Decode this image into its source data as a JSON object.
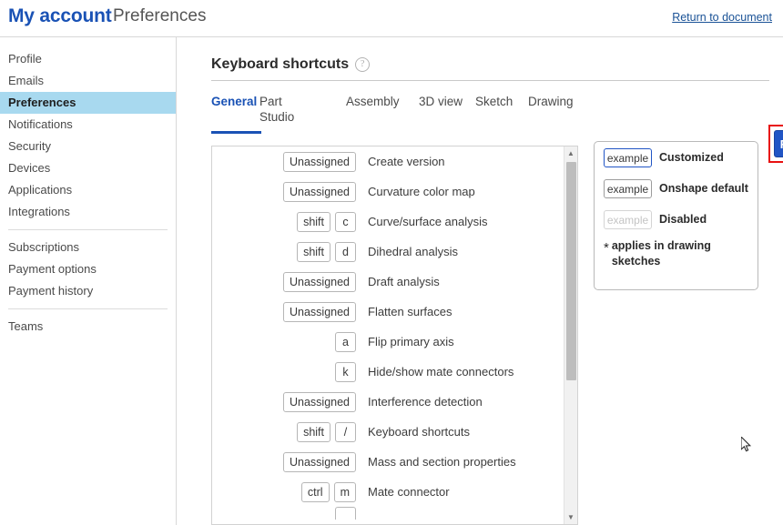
{
  "topbar": {
    "brand": "My account",
    "subtitle": "Preferences",
    "return_link": "Return to document"
  },
  "sidebar": {
    "group1": [
      {
        "label": "Profile",
        "active": false
      },
      {
        "label": "Emails",
        "active": false
      },
      {
        "label": "Preferences",
        "active": true
      },
      {
        "label": "Notifications",
        "active": false
      },
      {
        "label": "Security",
        "active": false
      },
      {
        "label": "Devices",
        "active": false
      },
      {
        "label": "Applications",
        "active": false
      },
      {
        "label": "Integrations",
        "active": false
      }
    ],
    "group2": [
      {
        "label": "Subscriptions",
        "active": false
      },
      {
        "label": "Payment options",
        "active": false
      },
      {
        "label": "Payment history",
        "active": false
      }
    ],
    "group3": [
      {
        "label": "Teams",
        "active": false
      }
    ]
  },
  "main": {
    "section_title": "Keyboard shortcuts",
    "help_icon": "question-mark-icon",
    "tabs": [
      {
        "label": "General",
        "active": true
      },
      {
        "label": "Part Studio",
        "active": false
      },
      {
        "label": "Assembly",
        "active": false
      },
      {
        "label": "3D view",
        "active": false
      },
      {
        "label": "Sketch",
        "active": false
      },
      {
        "label": "Drawing",
        "active": false
      }
    ],
    "reset_button": "Reset all",
    "highlight_color": "#e81111",
    "accent_color": "#1a52b5",
    "shortcuts": [
      {
        "keys": [
          "Unassigned"
        ],
        "label": "Create version"
      },
      {
        "keys": [
          "Unassigned"
        ],
        "label": "Curvature color map"
      },
      {
        "keys": [
          "shift",
          "c"
        ],
        "label": "Curve/surface analysis"
      },
      {
        "keys": [
          "shift",
          "d"
        ],
        "label": "Dihedral analysis"
      },
      {
        "keys": [
          "Unassigned"
        ],
        "label": "Draft analysis"
      },
      {
        "keys": [
          "Unassigned"
        ],
        "label": "Flatten surfaces"
      },
      {
        "keys": [
          "a"
        ],
        "label": "Flip primary axis"
      },
      {
        "keys": [
          "k"
        ],
        "label": "Hide/show mate connectors"
      },
      {
        "keys": [
          "Unassigned"
        ],
        "label": "Interference detection"
      },
      {
        "keys": [
          "shift",
          "/"
        ],
        "label": "Keyboard shortcuts"
      },
      {
        "keys": [
          "Unassigned"
        ],
        "label": "Mass and section properties"
      },
      {
        "keys": [
          "ctrl",
          "m"
        ],
        "label": "Mate connector"
      }
    ],
    "scrollbar": {
      "up_arrow": "scroll-up-icon",
      "down_arrow": "scroll-down-icon"
    },
    "legend": [
      {
        "chip": "example",
        "label": "Customized",
        "style": "chip-custom"
      },
      {
        "chip": "example",
        "label": "Onshape default",
        "style": "chip-default"
      },
      {
        "chip": "example",
        "label": "Disabled",
        "style": "chip-disabled"
      }
    ],
    "legend_note_star": "*",
    "legend_note": "applies in drawing sketches"
  }
}
